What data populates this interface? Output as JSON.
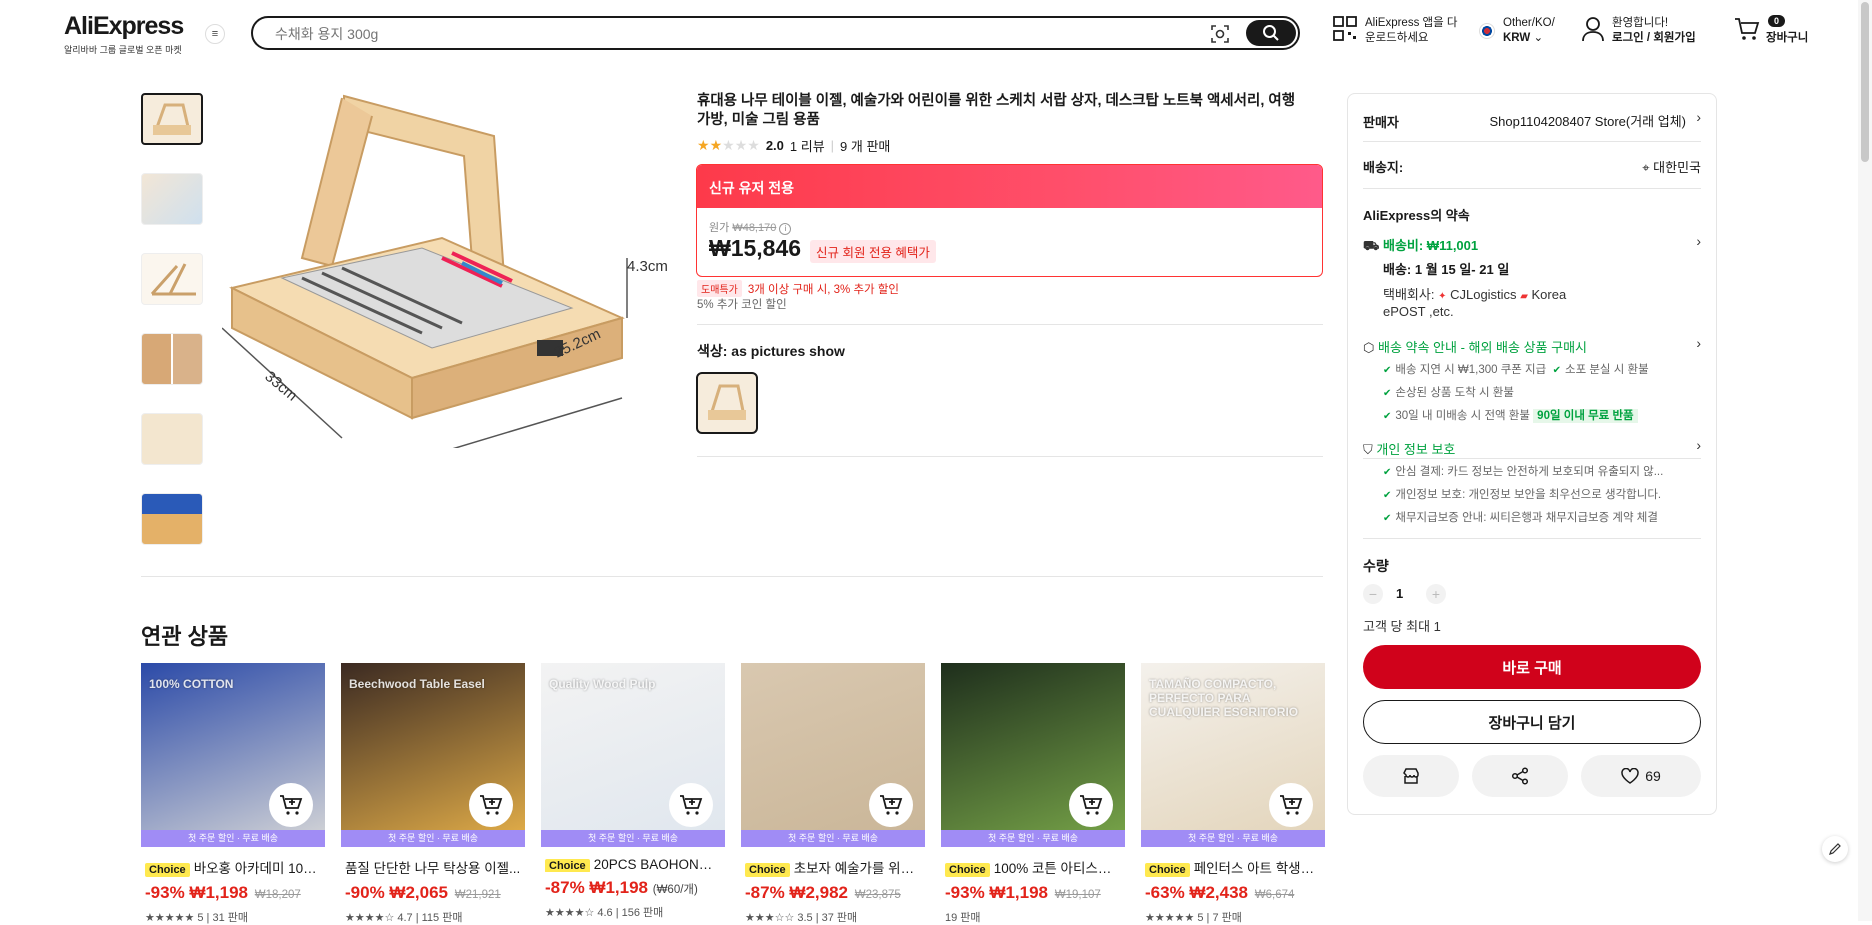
{
  "header": {
    "logo": "AliExpress",
    "logo_sub": "알리바바 그룹 글로벌 오픈 마켓",
    "search_placeholder": "수채화 용지 300g",
    "app_line1": "AliExpress 앱을 다",
    "app_line2": "운로드하세요",
    "region_line1": "Other/KO/",
    "region_line2": "KRW",
    "account_line1": "환영합니다!",
    "account_line2": "로그인 / 회원가입",
    "cart_count": "0",
    "cart_label": "장바구니"
  },
  "product": {
    "title": "휴대용 나무 테이블 이젤, 예술가와 어린이를 위한 스케치 서랍 상자, 데스크탑 노트북 액세서리, 여행 가방, 미술 그림 용품",
    "rating": "2.0",
    "stars": 2,
    "reviews": "1 리뷰",
    "sold": "9 개 판매",
    "banner": "신규 유저 전용",
    "orig_label": "원가",
    "orig_price": "₩48,170",
    "price": "₩15,846",
    "price_tag": "신규 회원 전용 혜택가",
    "promo_tag": "도매특가",
    "promo_text": "3개 이상 구매 시, 3% 추가 할인",
    "coin_text": "5% 추가 코인 할인",
    "color_label": "색상: as pictures show",
    "image_dim1": "4.3cm",
    "image_dim2": "25.2cm",
    "image_dim3": "33cm"
  },
  "panel": {
    "seller_label": "판매자",
    "seller_value": "Shop1104208407 Store(거래 업체)",
    "ship_to_label": "배송지:",
    "ship_to_value": "대한민국",
    "promise_title": "AliExpress의 약속",
    "shipping_fee": "배송비: ₩11,001",
    "delivery": "배송: 1 월 15 일- 21 일",
    "carrier_label": "택배회사:",
    "carrier_1": "CJLogistics",
    "carrier_2": "Korea",
    "carrier_3": "ePOST ,etc.",
    "guarantee_title": "배송 약속 안내 - 해외 배송 상품 구매시",
    "g1": "배송 지연 시 ₩1,300 쿠폰 지급",
    "g2": "소포 분실 시 환불",
    "g3": "손상된 상품 도착 시 환불",
    "g4": "30일 내 미배송 시 전액 환불",
    "g4_badge": "90일 이내 무료 반품",
    "privacy_title": "개인 정보 보호",
    "p1": "안심 결제: 카드 정보는 안전하게 보호되며 유출되지 않...",
    "p2": "개인정보 보호: 개인정보 보안을 최우선으로 생각합니다.",
    "p3": "채무지급보증 안내: 씨티은행과 채무지급보증 계약 체결",
    "qty_label": "수량",
    "qty_value": "1",
    "qty_limit": "고객 당 최대 1",
    "buy_now": "바로 구매",
    "add_cart": "장바구니 담기",
    "wish_count": "69"
  },
  "related": {
    "title": "연관 상품",
    "strip": "첫 주문 할인 · 무료 배송",
    "choice": "Choice",
    "items": [
      {
        "name": "바오홍 아카데미 100...",
        "choice": true,
        "discount": "-93%",
        "price": "₩1,198",
        "orig": "₩18,207",
        "unit": "",
        "meta": "★★★★★ 5 | 31 판매",
        "colors": [
          "#2b4aa8",
          "#d8d8d8"
        ],
        "img_text": "100% COTTON"
      },
      {
        "name": "품질 단단한 나무 탁상용 이젤...",
        "choice": false,
        "discount": "-90%",
        "price": "₩2,065",
        "orig": "₩21,921",
        "unit": "",
        "meta": "★★★★☆ 4.7 | 115 판매",
        "colors": [
          "#3b2a22",
          "#e8b24a"
        ],
        "img_text": "Beechwood Table Easel"
      },
      {
        "name": "20PCS BAOHONG ...",
        "choice": true,
        "discount": "-87%",
        "price": "₩1,198",
        "orig": "",
        "unit": "(₩60/개)",
        "meta": "★★★★☆ 4.6 | 156 판매",
        "colors": [
          "#f3f3f3",
          "#dfe6ee"
        ],
        "img_text": "Quality Wood Pulp"
      },
      {
        "name": "초보자 예술가를 위한 ...",
        "choice": true,
        "discount": "-87%",
        "price": "₩2,982",
        "orig": "₩23,875",
        "unit": "",
        "meta": "★★★☆☆ 3.5 | 37 판매",
        "colors": [
          "#d9c8b0",
          "#c9b597"
        ],
        "img_text": ""
      },
      {
        "name": "100% 코튼 아티스트 ...",
        "choice": true,
        "discount": "-93%",
        "price": "₩1,198",
        "orig": "₩19,107",
        "unit": "",
        "meta": "19 판매",
        "colors": [
          "#1e2e1c",
          "#7aa84a"
        ],
        "img_text": ""
      },
      {
        "name": "페인터스 아트 학생들...",
        "choice": true,
        "discount": "-63%",
        "price": "₩2,438",
        "orig": "₩6,674",
        "unit": "",
        "meta": "★★★★★ 5 | 7 판매",
        "colors": [
          "#f4f1ec",
          "#e2d3b8"
        ],
        "img_text": "TAMAÑO COMPACTO, PERFECTO PARA CUALQUIER ESCRITORIO"
      }
    ]
  }
}
